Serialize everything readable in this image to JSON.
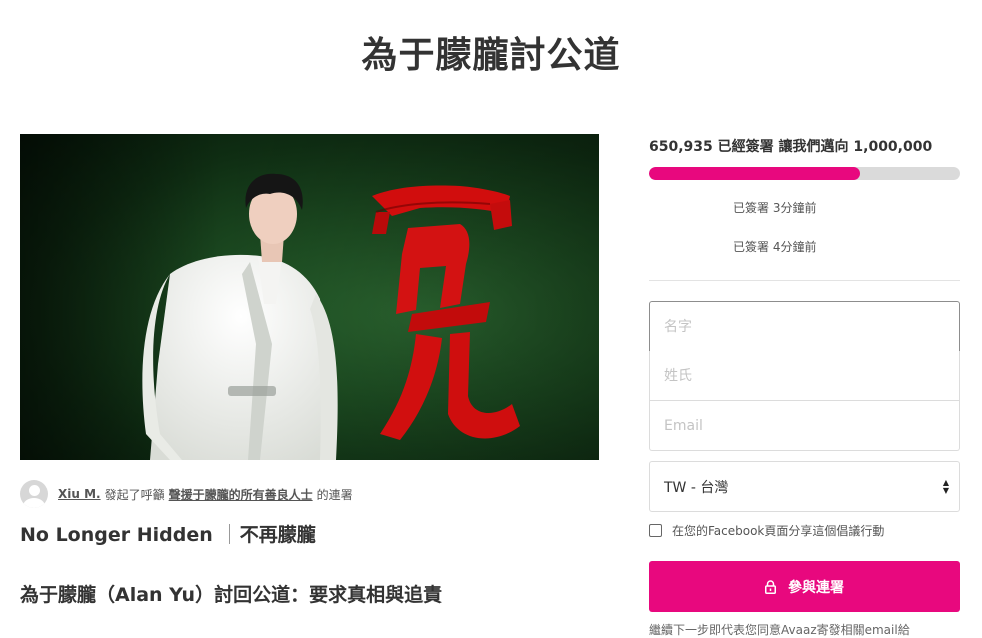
{
  "page": {
    "title": "為于朦朧討公道"
  },
  "hero": {
    "image_caption_char": "冤"
  },
  "starter": {
    "name": "Xiu M.",
    "action_text": "發起了呼籲",
    "recipient": "聲援于朦朧的所有善良人士",
    "suffix": "的連署"
  },
  "content": {
    "subtitle_en": "No Longer Hidden",
    "subtitle_zh": "不再朦朧",
    "headline": "為于朦朧（Alan Yu）討回公道：要求真相與追責"
  },
  "progress": {
    "signed_count": "650,935",
    "signed_label": "已經簽署",
    "goal_label": "讓我們邁向",
    "goal": "1,000,000",
    "fraction": 0.68,
    "colors": {
      "fill": "#e8087e",
      "track": "#dadada"
    }
  },
  "recent_signers": [
    {
      "text": "已簽署 3分鐘前"
    },
    {
      "text": "已簽署 4分鐘前"
    }
  ],
  "form": {
    "first_name_placeholder": "名字",
    "last_name_placeholder": "姓氏",
    "email_placeholder": "Email",
    "country_value": "TW - 台灣",
    "share_label": "在您的Facebook頁面分享這個倡議行動",
    "sign_button_label": "參與連署",
    "sign_button_icon": "lock-icon",
    "legal_text": "繼續下一步即代表您同意Avaaz寄發相關email給"
  },
  "colors": {
    "accent": "#e8087e",
    "text": "#333333"
  }
}
